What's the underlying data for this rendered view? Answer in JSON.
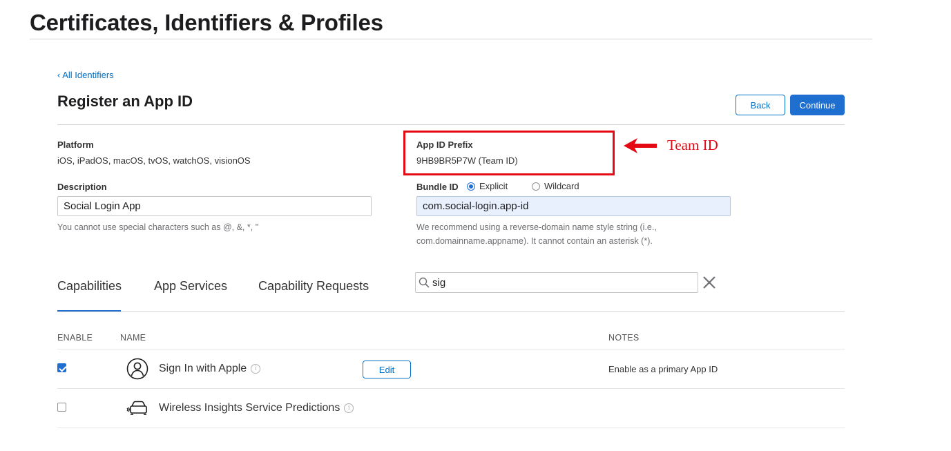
{
  "header": {
    "title": "Certificates, Identifiers & Profiles"
  },
  "nav": {
    "back_link": "‹ All Identifiers"
  },
  "form": {
    "title": "Register an App ID",
    "back_label": "Back",
    "continue_label": "Continue",
    "platform": {
      "label": "Platform",
      "value": "iOS, iPadOS, macOS, tvOS, watchOS, visionOS"
    },
    "prefix": {
      "label": "App ID Prefix",
      "value": "9HB9BR5P7W (Team ID)"
    },
    "description": {
      "label": "Description",
      "value": "Social Login App",
      "help": "You cannot use special characters such as @, &, *, \""
    },
    "bundle": {
      "label": "Bundle ID",
      "explicit_label": "Explicit",
      "wildcard_label": "Wildcard",
      "selected": "explicit",
      "value": "com.social-login.app-id",
      "help_line1": "We recommend using a reverse-domain name style string (i.e.,",
      "help_line2": "com.domainname.appname). It cannot contain an asterisk (*)."
    }
  },
  "annotation": {
    "text": "Team ID",
    "color": "#e50914"
  },
  "tabs": [
    {
      "label": "Capabilities",
      "active": true
    },
    {
      "label": "App Services",
      "active": false
    },
    {
      "label": "Capability Requests",
      "active": false
    }
  ],
  "search": {
    "value": "sig"
  },
  "table": {
    "headers": {
      "enable": "ENABLE",
      "name": "NAME",
      "notes": "NOTES"
    },
    "rows": [
      {
        "name": "Sign In with Apple",
        "enabled": true,
        "has_edit": true,
        "edit_label": "Edit",
        "note": "Enable as a primary App ID",
        "icon": "person-circle-icon"
      },
      {
        "name": "Wireless Insights Service Predictions",
        "enabled": false,
        "has_edit": false,
        "note": "",
        "icon": "car-wireless-icon"
      }
    ]
  },
  "colors": {
    "accent": "#1f6fd1",
    "link": "#0070c9",
    "highlight": "#e50914"
  }
}
